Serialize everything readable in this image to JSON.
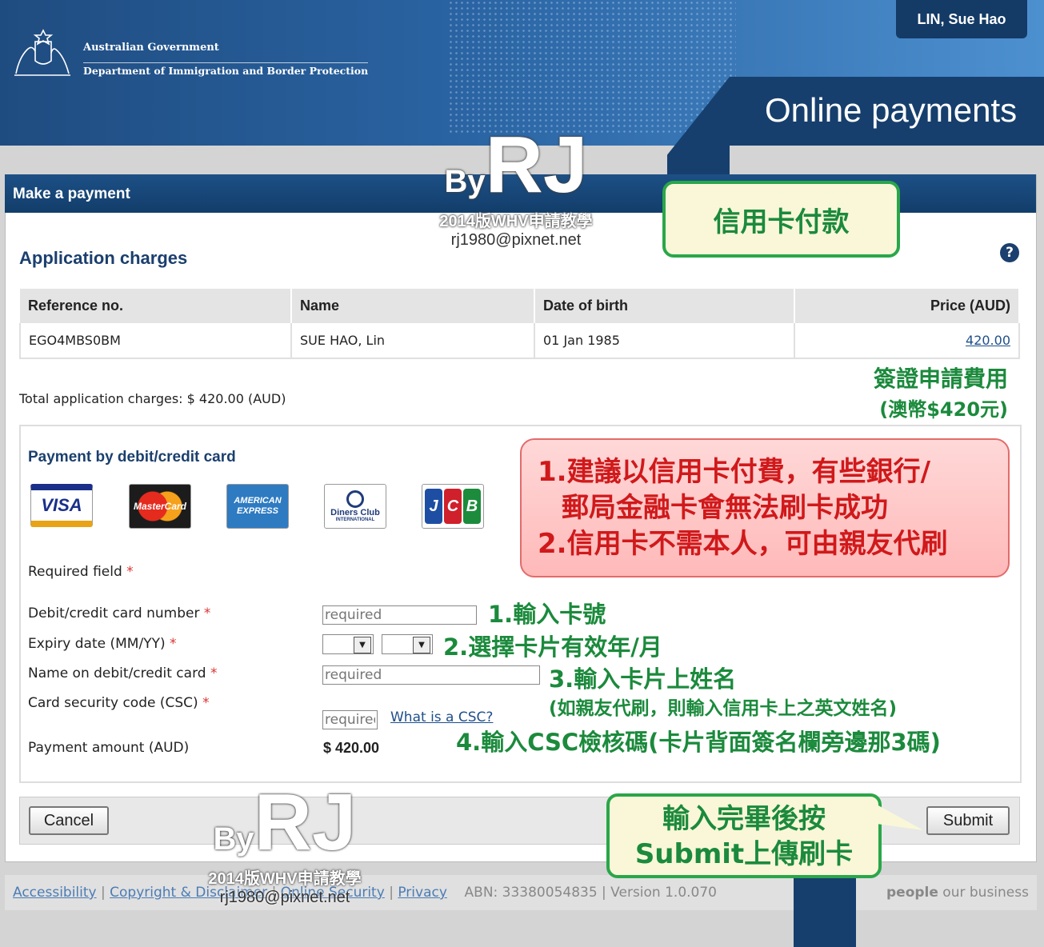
{
  "header": {
    "gov_line1": "Australian Government",
    "gov_line2": "Department of Immigration and Border Protection",
    "user_name": "LIN, Sue Hao",
    "page_title": "Online payments"
  },
  "panel": {
    "title": "Make a payment",
    "section_title": "Application charges",
    "help_label": "?"
  },
  "table": {
    "headers": [
      "Reference no.",
      "Name",
      "Date of birth",
      "Price (AUD)"
    ],
    "rows": [
      {
        "ref": "EGO4MBS0BM",
        "name": "SUE HAO, Lin",
        "dob": "01 Jan 1985",
        "price": "420.00"
      }
    ]
  },
  "total_line": "Total application charges: $ 420.00 (AUD)",
  "payment": {
    "title": "Payment by debit/credit card",
    "cards": [
      "VISA",
      "MasterCard",
      "AMERICAN EXPRESS",
      "Diners Club",
      "JCB"
    ],
    "diners_sub": "INTERNATIONAL",
    "required_note": "Required field",
    "required_mark": "*",
    "fields": {
      "card_number": {
        "label": "Debit/credit card number",
        "placeholder": "required"
      },
      "expiry": {
        "label": "Expiry date (MM/YY)"
      },
      "name_on_card": {
        "label": "Name on debit/credit card",
        "placeholder": "required"
      },
      "csc": {
        "label": "Card security code (CSC)",
        "placeholder": "required",
        "help_link": "What is a CSC?"
      },
      "amount": {
        "label": "Payment amount (AUD)",
        "value": "$ 420.00"
      }
    }
  },
  "buttons": {
    "cancel": "Cancel",
    "submit": "Submit"
  },
  "footer": {
    "links": [
      "Accessibility",
      "Copyright & Disclaimer",
      "Online Security",
      "Privacy"
    ],
    "abn": "ABN: 33380054835 | Version 1.0.070",
    "brand_bold": "people",
    "brand_rest": " our business"
  },
  "annotations": {
    "top_box": "信用卡付款",
    "fee_line1": "簽證申請費用",
    "fee_line2": "(澳幣$420元)",
    "red_line1": "1.建議以信用卡付費，有些銀行/",
    "red_line2": "郵局金融卡會無法刷卡成功",
    "red_line3": "2.信用卡不需本人，可由親友代刷",
    "step1": "1.輸入卡號",
    "step2": "2.選擇卡片有效年/月",
    "step3": "3.輸入卡片上姓名",
    "step3_note": "(如親友代刷，則輸入信用卡上之英文姓名)",
    "step4": "4.輸入CSC檢核碼(卡片背面簽名欄旁邊那3碼)",
    "submit_line1": "輸入完畢後按",
    "submit_line2": "Submit上傳刷卡"
  },
  "watermark": {
    "by": "By",
    "initials": "RJ",
    "subtitle": "2014版WHV申請教學",
    "email": "rj1980@pixnet.net"
  },
  "colors": {
    "header_blue": "#1f4c80",
    "annotation_green": "#1b8a3c",
    "annotation_red": "#d0191b"
  }
}
